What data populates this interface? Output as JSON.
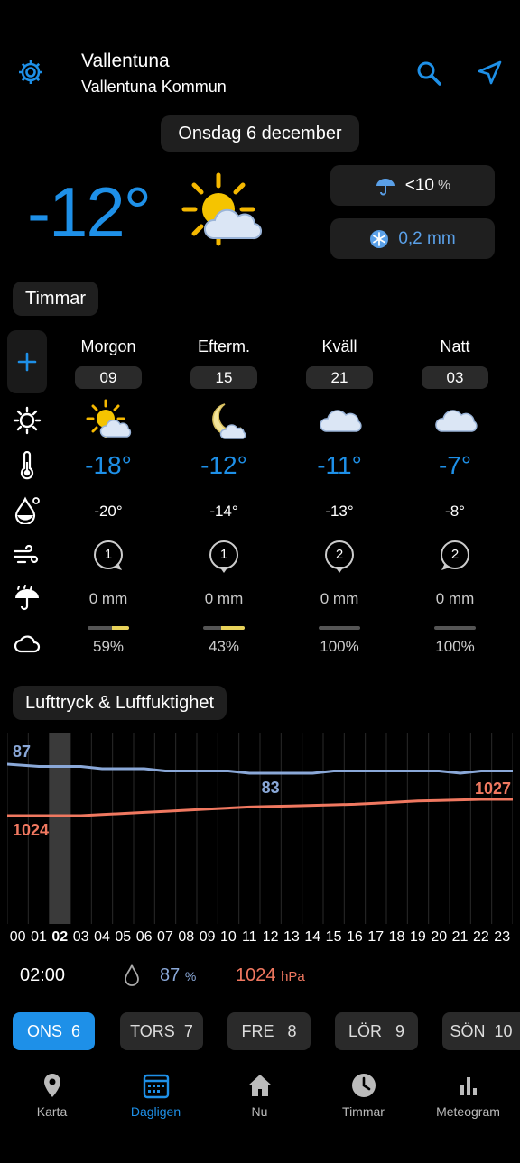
{
  "header": {
    "city": "Vallentuna",
    "municipality": "Vallentuna Kommun"
  },
  "date_label": "Onsdag 6 december",
  "current": {
    "temperature": "-12°",
    "precip_chance": "<10",
    "precip_chance_unit": "%",
    "snow_amount": "0,2 mm"
  },
  "hours_section": {
    "title": "Timmar"
  },
  "periods": [
    {
      "name": "Morgon",
      "hour": "09",
      "temp": "-18°",
      "feels": "-20°",
      "wind": "1",
      "precip": "0 mm",
      "cloud": "59%",
      "cloud_frac": 0.41
    },
    {
      "name": "Efterm.",
      "hour": "15",
      "temp": "-12°",
      "feels": "-14°",
      "wind": "1",
      "precip": "0 mm",
      "cloud": "43%",
      "cloud_frac": 0.57
    },
    {
      "name": "Kväll",
      "hour": "21",
      "temp": "-11°",
      "feels": "-13°",
      "wind": "2",
      "precip": "0 mm",
      "cloud": "100%",
      "cloud_frac": 0
    },
    {
      "name": "Natt",
      "hour": "03",
      "temp": "-7°",
      "feels": "-8°",
      "wind": "2",
      "precip": "0 mm",
      "cloud": "100%",
      "cloud_frac": 0
    }
  ],
  "chart_section": {
    "title": "Lufttryck & Luftfuktighet"
  },
  "chart_data": {
    "type": "line",
    "x": [
      "00",
      "01",
      "02",
      "03",
      "04",
      "05",
      "06",
      "07",
      "08",
      "09",
      "10",
      "11",
      "12",
      "13",
      "14",
      "15",
      "16",
      "17",
      "18",
      "19",
      "20",
      "21",
      "22",
      "23"
    ],
    "selected_x": "02",
    "series": [
      {
        "values": [
          87,
          86,
          86,
          86,
          85,
          85,
          85,
          84,
          84,
          84,
          84,
          83,
          83,
          83,
          83,
          84,
          84,
          84,
          84,
          84,
          84,
          83,
          84,
          84
        ],
        "color": "#8aa8d8"
      },
      {
        "values": [
          1024,
          1024,
          1024,
          1024,
          1024.2,
          1024.4,
          1024.6,
          1024.8,
          1025,
          1025.2,
          1025.4,
          1025.6,
          1025.7,
          1025.8,
          1025.9,
          1026,
          1026.1,
          1026.3,
          1026.5,
          1026.7,
          1026.8,
          1026.9,
          1027,
          1027
        ],
        "color": "#f07860"
      }
    ],
    "point_labels": [
      {
        "series": 0,
        "x": "00",
        "text": "87"
      },
      {
        "series": 0,
        "x": "12",
        "text": "83"
      },
      {
        "series": 1,
        "x": "00",
        "text": "1024"
      },
      {
        "series": 1,
        "x": "23",
        "text": "1027"
      }
    ]
  },
  "readout": {
    "time": "02:00",
    "humidity": "87",
    "humidity_unit": "%",
    "pressure": "1024",
    "pressure_unit": "hPa"
  },
  "days": [
    {
      "name": "ONS",
      "num": "6",
      "selected": true
    },
    {
      "name": "TORS",
      "num": "7"
    },
    {
      "name": "FRE",
      "num": "8"
    },
    {
      "name": "LÖR",
      "num": "9"
    },
    {
      "name": "SÖN",
      "num": "10"
    }
  ],
  "nav": [
    {
      "label": "Karta",
      "icon": "map-pin-icon"
    },
    {
      "label": "Dagligen",
      "icon": "calendar-icon",
      "selected": true
    },
    {
      "label": "Nu",
      "icon": "home-icon"
    },
    {
      "label": "Timmar",
      "icon": "clock-icon"
    },
    {
      "label": "Meteogram",
      "icon": "bar-chart-icon"
    }
  ],
  "colors": {
    "accent": "#1e90e8",
    "humidity": "#8aa8d8",
    "pressure": "#f07860"
  }
}
